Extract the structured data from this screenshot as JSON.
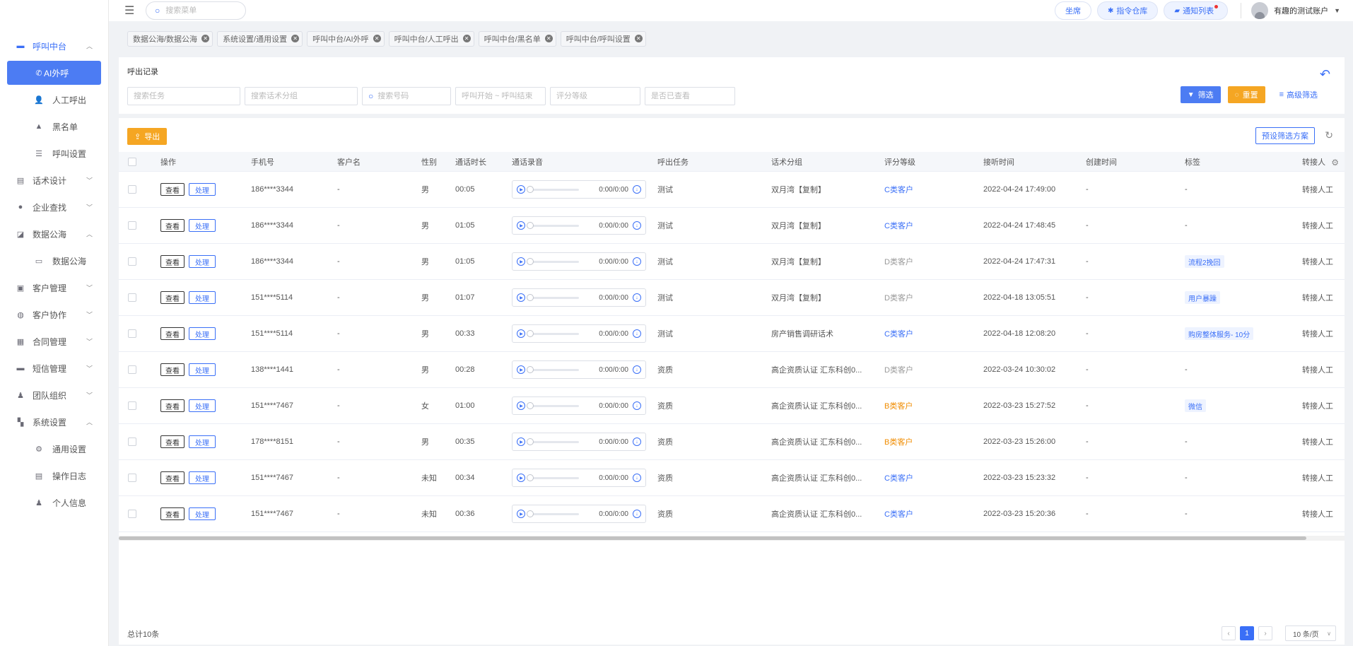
{
  "topbar": {
    "search_placeholder": "搜索菜单",
    "btn_seat": "坐席",
    "btn_commands": "指令仓库",
    "btn_notify": "通知列表",
    "user_name": "有趣的测试账户"
  },
  "sidebar": {
    "items": [
      {
        "label": "呼叫中台",
        "icon": "monitor-icon",
        "level": 1,
        "arrow": "up",
        "state": "open"
      },
      {
        "label": "AI外呼",
        "icon": "phone-icon",
        "level": 2,
        "state": "active"
      },
      {
        "label": "人工呼出",
        "icon": "people-icon",
        "level": 2
      },
      {
        "label": "黑名单",
        "icon": "warning-icon",
        "level": 2
      },
      {
        "label": "呼叫设置",
        "icon": "sliders-icon",
        "level": 2
      },
      {
        "label": "话术设计",
        "icon": "card-icon",
        "level": 1,
        "arrow": "down"
      },
      {
        "label": "企业查找",
        "icon": "bulb-icon",
        "level": 1,
        "arrow": "down"
      },
      {
        "label": "数据公海",
        "icon": "chart-icon",
        "level": 1,
        "arrow": "up"
      },
      {
        "label": "数据公海",
        "icon": "screen-icon",
        "level": 2
      },
      {
        "label": "客户管理",
        "icon": "contacts-icon",
        "level": 1,
        "arrow": "down"
      },
      {
        "label": "客户协作",
        "icon": "globe-icon",
        "level": 1,
        "arrow": "down"
      },
      {
        "label": "合同管理",
        "icon": "clipboard-icon",
        "level": 1,
        "arrow": "down"
      },
      {
        "label": "短信管理",
        "icon": "message-icon",
        "level": 1,
        "arrow": "down"
      },
      {
        "label": "团队组织",
        "icon": "team-icon",
        "level": 1,
        "arrow": "down"
      },
      {
        "label": "系统设置",
        "icon": "dashboard-icon",
        "level": 1,
        "arrow": "up"
      },
      {
        "label": "通用设置",
        "icon": "gear-icon",
        "level": 2
      },
      {
        "label": "操作日志",
        "icon": "log-icon",
        "level": 2
      },
      {
        "label": "个人信息",
        "icon": "user-icon",
        "level": 2
      }
    ]
  },
  "tabs": [
    "数据公海/数据公海",
    "系统设置/通用设置",
    "呼叫中台/AI外呼",
    "呼叫中台/人工呼出",
    "呼叫中台/黑名单",
    "呼叫中台/呼叫设置"
  ],
  "filter": {
    "title": "呼出记录",
    "placeholders": [
      "搜索任务",
      "搜索话术分组",
      "搜索号码",
      "呼叫开始 ~ 呼叫结束",
      "评分等级",
      "是否已查看"
    ],
    "btn_filter": "筛选",
    "btn_reset": "重置",
    "btn_advanced": "高级筛选"
  },
  "table": {
    "btn_export": "导出",
    "btn_preset": "预设筛选方案",
    "columns": [
      "操作",
      "手机号",
      "客户名",
      "性别",
      "通话时长",
      "通话录音",
      "呼出任务",
      "话术分组",
      "评分等级",
      "接听时间",
      "创建时间",
      "标签",
      "转接人"
    ],
    "btn_view": "查看",
    "btn_handle": "处理",
    "audio_time": "0:00/0:00",
    "rows": [
      {
        "phone": "186****3344",
        "name": "-",
        "gender": "男",
        "duration": "00:05",
        "task": "测试",
        "group": "双月湾【复制】",
        "grade": "C类客户",
        "answer_time": "2022-04-24 17:49:00",
        "created": "-",
        "tag": "-",
        "transfer": "转接人工"
      },
      {
        "phone": "186****3344",
        "name": "-",
        "gender": "男",
        "duration": "01:05",
        "task": "测试",
        "group": "双月湾【复制】",
        "grade": "C类客户",
        "answer_time": "2022-04-24 17:48:45",
        "created": "-",
        "tag": "-",
        "transfer": "转接人工"
      },
      {
        "phone": "186****3344",
        "name": "-",
        "gender": "男",
        "duration": "01:05",
        "task": "测试",
        "group": "双月湾【复制】",
        "grade": "D类客户",
        "answer_time": "2022-04-24 17:47:31",
        "created": "-",
        "tag": "流程2挽回",
        "transfer": "转接人工"
      },
      {
        "phone": "151****5114",
        "name": "-",
        "gender": "男",
        "duration": "01:07",
        "task": "测试",
        "group": "双月湾【复制】",
        "grade": "D类客户",
        "answer_time": "2022-04-18 13:05:51",
        "created": "-",
        "tag": "用户暴躁",
        "transfer": "转接人工"
      },
      {
        "phone": "151****5114",
        "name": "-",
        "gender": "男",
        "duration": "00:33",
        "task": "测试",
        "group": "房产销售调研话术",
        "grade": "C类客户",
        "answer_time": "2022-04-18 12:08:20",
        "created": "-",
        "tag": "购房整体服务- 10分",
        "transfer": "转接人工"
      },
      {
        "phone": "138****1441",
        "name": "-",
        "gender": "男",
        "duration": "00:28",
        "task": "资质",
        "group": "高企资质认证 汇东科创0...",
        "grade": "D类客户",
        "answer_time": "2022-03-24 10:30:02",
        "created": "-",
        "tag": "-",
        "transfer": "转接人工"
      },
      {
        "phone": "151****7467",
        "name": "-",
        "gender": "女",
        "duration": "01:00",
        "task": "资质",
        "group": "高企资质认证 汇东科创0...",
        "grade": "B类客户",
        "answer_time": "2022-03-23 15:27:52",
        "created": "-",
        "tag": "微信",
        "transfer": "转接人工"
      },
      {
        "phone": "178****8151",
        "name": "-",
        "gender": "男",
        "duration": "00:35",
        "task": "资质",
        "group": "高企资质认证 汇东科创0...",
        "grade": "B类客户",
        "answer_time": "2022-03-23 15:26:00",
        "created": "-",
        "tag": "-",
        "transfer": "转接人工"
      },
      {
        "phone": "151****7467",
        "name": "-",
        "gender": "未知",
        "duration": "00:34",
        "task": "资质",
        "group": "高企资质认证 汇东科创0...",
        "grade": "C类客户",
        "answer_time": "2022-03-23 15:23:32",
        "created": "-",
        "tag": "-",
        "transfer": "转接人工"
      },
      {
        "phone": "151****7467",
        "name": "-",
        "gender": "未知",
        "duration": "00:36",
        "task": "资质",
        "group": "高企资质认证 汇东科创0...",
        "grade": "C类客户",
        "answer_time": "2022-03-23 15:20:36",
        "created": "-",
        "tag": "-",
        "transfer": "转接人工"
      }
    ]
  },
  "footer": {
    "total": "总计10条",
    "current_page": "1",
    "page_size": "10 条/页"
  },
  "colors": {
    "primary": "#3a6ff7",
    "orange": "#f5a623",
    "grade_B": "#f08c00",
    "grade_C": "#3a6ff7",
    "grade_D": "#999999"
  }
}
